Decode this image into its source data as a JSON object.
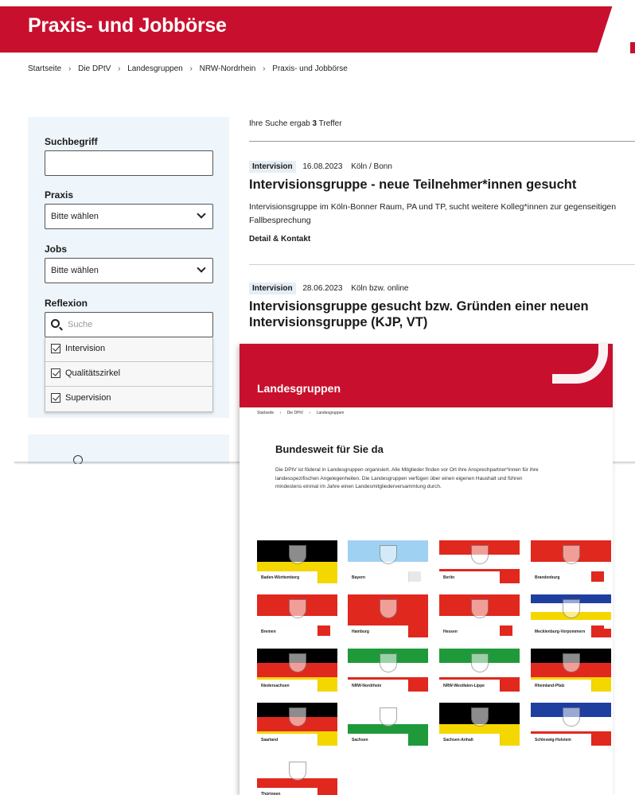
{
  "back_page": {
    "header_title": "Praxis- und Jobbörse",
    "breadcrumb": [
      "Startseite",
      "Die DPtV",
      "Landesgruppen",
      "NRW-Nordrhein",
      "Praxis- und Jobbörse"
    ],
    "breadcrumb_sep": "›",
    "filters": {
      "search_label": "Suchbegriff",
      "search_value": "",
      "praxis_label": "Praxis",
      "praxis_value": "Bitte wählen",
      "jobs_label": "Jobs",
      "jobs_value": "Bitte wählen",
      "reflexion_label": "Reflexion",
      "reflexion_search_placeholder": "Suche",
      "reflexion_options": [
        {
          "label": "Intervision",
          "checked": true
        },
        {
          "label": "Qualitätszirkel",
          "checked": true
        },
        {
          "label": "Supervision",
          "checked": true
        }
      ]
    },
    "results": {
      "count_prefix": "Ihre Suche ergab",
      "count": "3",
      "count_suffix": "Treffer",
      "items": [
        {
          "tag": "Intervision",
          "date": "16.08.2023",
          "location": "Köln / Bonn",
          "title": "Intervisionsgruppe - neue Teilnehmer*innen gesucht",
          "desc_line1": "Intervisionsgruppe im Köln-Bonner Raum, PA und TP, sucht weitere Kolleg*innen zur gegenseitigen",
          "desc_line2": "Fallbesprechung",
          "link": "Detail & Kontakt"
        },
        {
          "tag": "Intervision",
          "date": "28.06.2023",
          "location": "Köln bzw. online",
          "title_line1": "Intervisionsgruppe gesucht bzw. Gründen einer neuen",
          "title_line2": "Intervisionsgruppe (KJP, VT)"
        }
      ]
    }
  },
  "front_page": {
    "header_title": "Landesgruppen",
    "breadcrumb": [
      "Startseite",
      "Die DPtV",
      "Landesgruppen"
    ],
    "breadcrumb_sep": "›",
    "heading": "Bundesweit für Sie da",
    "intro": "Die DPtV ist föderal in Landesgruppen organisiert. Alle Mitglieder finden vor Ort ihre Ansprechpartner*innen für ihre landesspezifischen Angelegenheiten. Die Landesgruppen verfügen über einen eigenen Haushalt und führen mindestens einmal im Jahre einen Landesmitgliederversammlung durch.",
    "states": [
      {
        "name": "Baden-Württemberg",
        "colors": [
          "#000000",
          "#f5d700"
        ],
        "accent": "#f5d700"
      },
      {
        "name": "Bayern",
        "colors": [
          "#9fd1f2",
          "#ffffff"
        ],
        "accent": "#e8e8e8"
      },
      {
        "name": "Berlin",
        "colors": [
          "#e1281e",
          "#ffffff",
          "#e1281e"
        ],
        "accent": "#e1281e"
      },
      {
        "name": "Brandenburg",
        "colors": [
          "#e1281e",
          "#ffffff"
        ],
        "accent": "#e1281e"
      },
      {
        "name": "Bremen",
        "colors": [
          "#e1281e",
          "#ffffff"
        ],
        "accent": "#e1281e"
      },
      {
        "name": "Hamburg",
        "colors": [
          "#e1281e",
          "#e1281e"
        ],
        "accent": "#e1281e"
      },
      {
        "name": "Hessen",
        "colors": [
          "#e1281e",
          "#ffffff"
        ],
        "accent": "#e1281e"
      },
      {
        "name": "Mecklenburg-Vorpommern",
        "colors": [
          "#1e3fa0",
          "#ffffff",
          "#f5d700",
          "#ffffff",
          "#e1281e"
        ],
        "accent": "#e1281e"
      },
      {
        "name": "Niedersachsen",
        "colors": [
          "#000000",
          "#e1281e",
          "#f5d700"
        ],
        "accent": "#f5d700"
      },
      {
        "name": "NRW-Nordrhein",
        "colors": [
          "#1f9a3a",
          "#ffffff",
          "#e1281e"
        ],
        "accent": "#e1281e"
      },
      {
        "name": "NRW-Westfalen-Lippe",
        "colors": [
          "#1f9a3a",
          "#ffffff",
          "#e1281e"
        ],
        "accent": "#e1281e"
      },
      {
        "name": "Rheinland-Pfalz",
        "colors": [
          "#000000",
          "#e1281e",
          "#f5d700"
        ],
        "accent": "#f5d700"
      },
      {
        "name": "Saarland",
        "colors": [
          "#000000",
          "#e1281e",
          "#f5d700"
        ],
        "accent": "#f5d700"
      },
      {
        "name": "Sachsen",
        "colors": [
          "#ffffff",
          "#1f9a3a"
        ],
        "accent": "#1f9a3a"
      },
      {
        "name": "Sachsen-Anhalt",
        "colors": [
          "#000000",
          "#f5d700"
        ],
        "accent": "#f5d700"
      },
      {
        "name": "Schleswig-Holstein",
        "colors": [
          "#1e3fa0",
          "#ffffff",
          "#e1281e"
        ],
        "accent": "#e1281e"
      },
      {
        "name": "Thüringen",
        "colors": [
          "#ffffff",
          "#e1281e"
        ],
        "accent": "#e1281e"
      }
    ]
  }
}
